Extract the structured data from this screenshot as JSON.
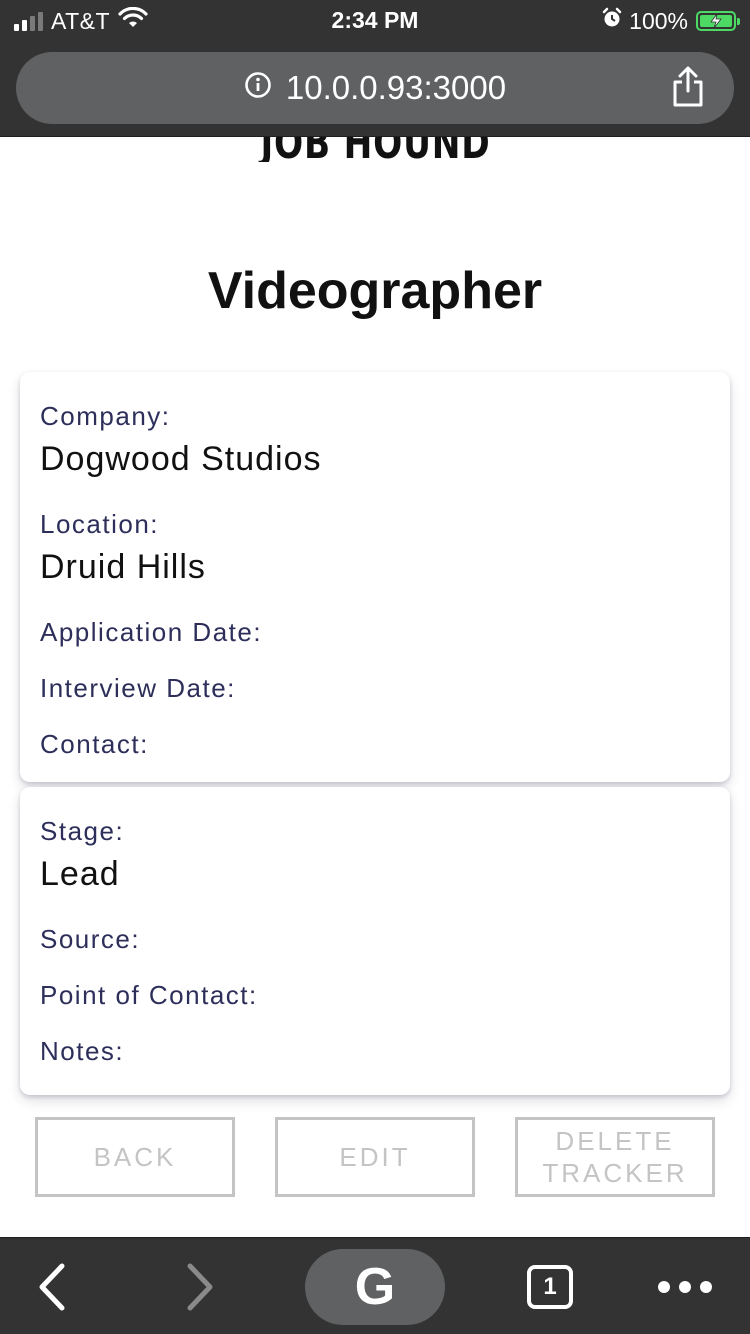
{
  "status_bar": {
    "carrier": "AT&T",
    "time": "2:34 PM",
    "battery": "100%"
  },
  "browser": {
    "url": "10.0.0.93:3000",
    "tab_count": "1",
    "google_label": "G"
  },
  "page": {
    "logo": "JOB HOUND",
    "title": "Videographer"
  },
  "details": {
    "company_label": "Company:",
    "company_value": "Dogwood Studios",
    "location_label": "Location:",
    "location_value": "Druid Hills",
    "application_date_label": "Application Date:",
    "interview_date_label": "Interview Date:",
    "contact_label": "Contact:"
  },
  "tracking": {
    "stage_label": "Stage:",
    "stage_value": "Lead",
    "source_label": "Source:",
    "point_of_contact_label": "Point of Contact:",
    "notes_label": "Notes:"
  },
  "actions": {
    "back_label": "BACK",
    "edit_label": "EDIT",
    "delete_label": "DELETE TRACKER"
  }
}
